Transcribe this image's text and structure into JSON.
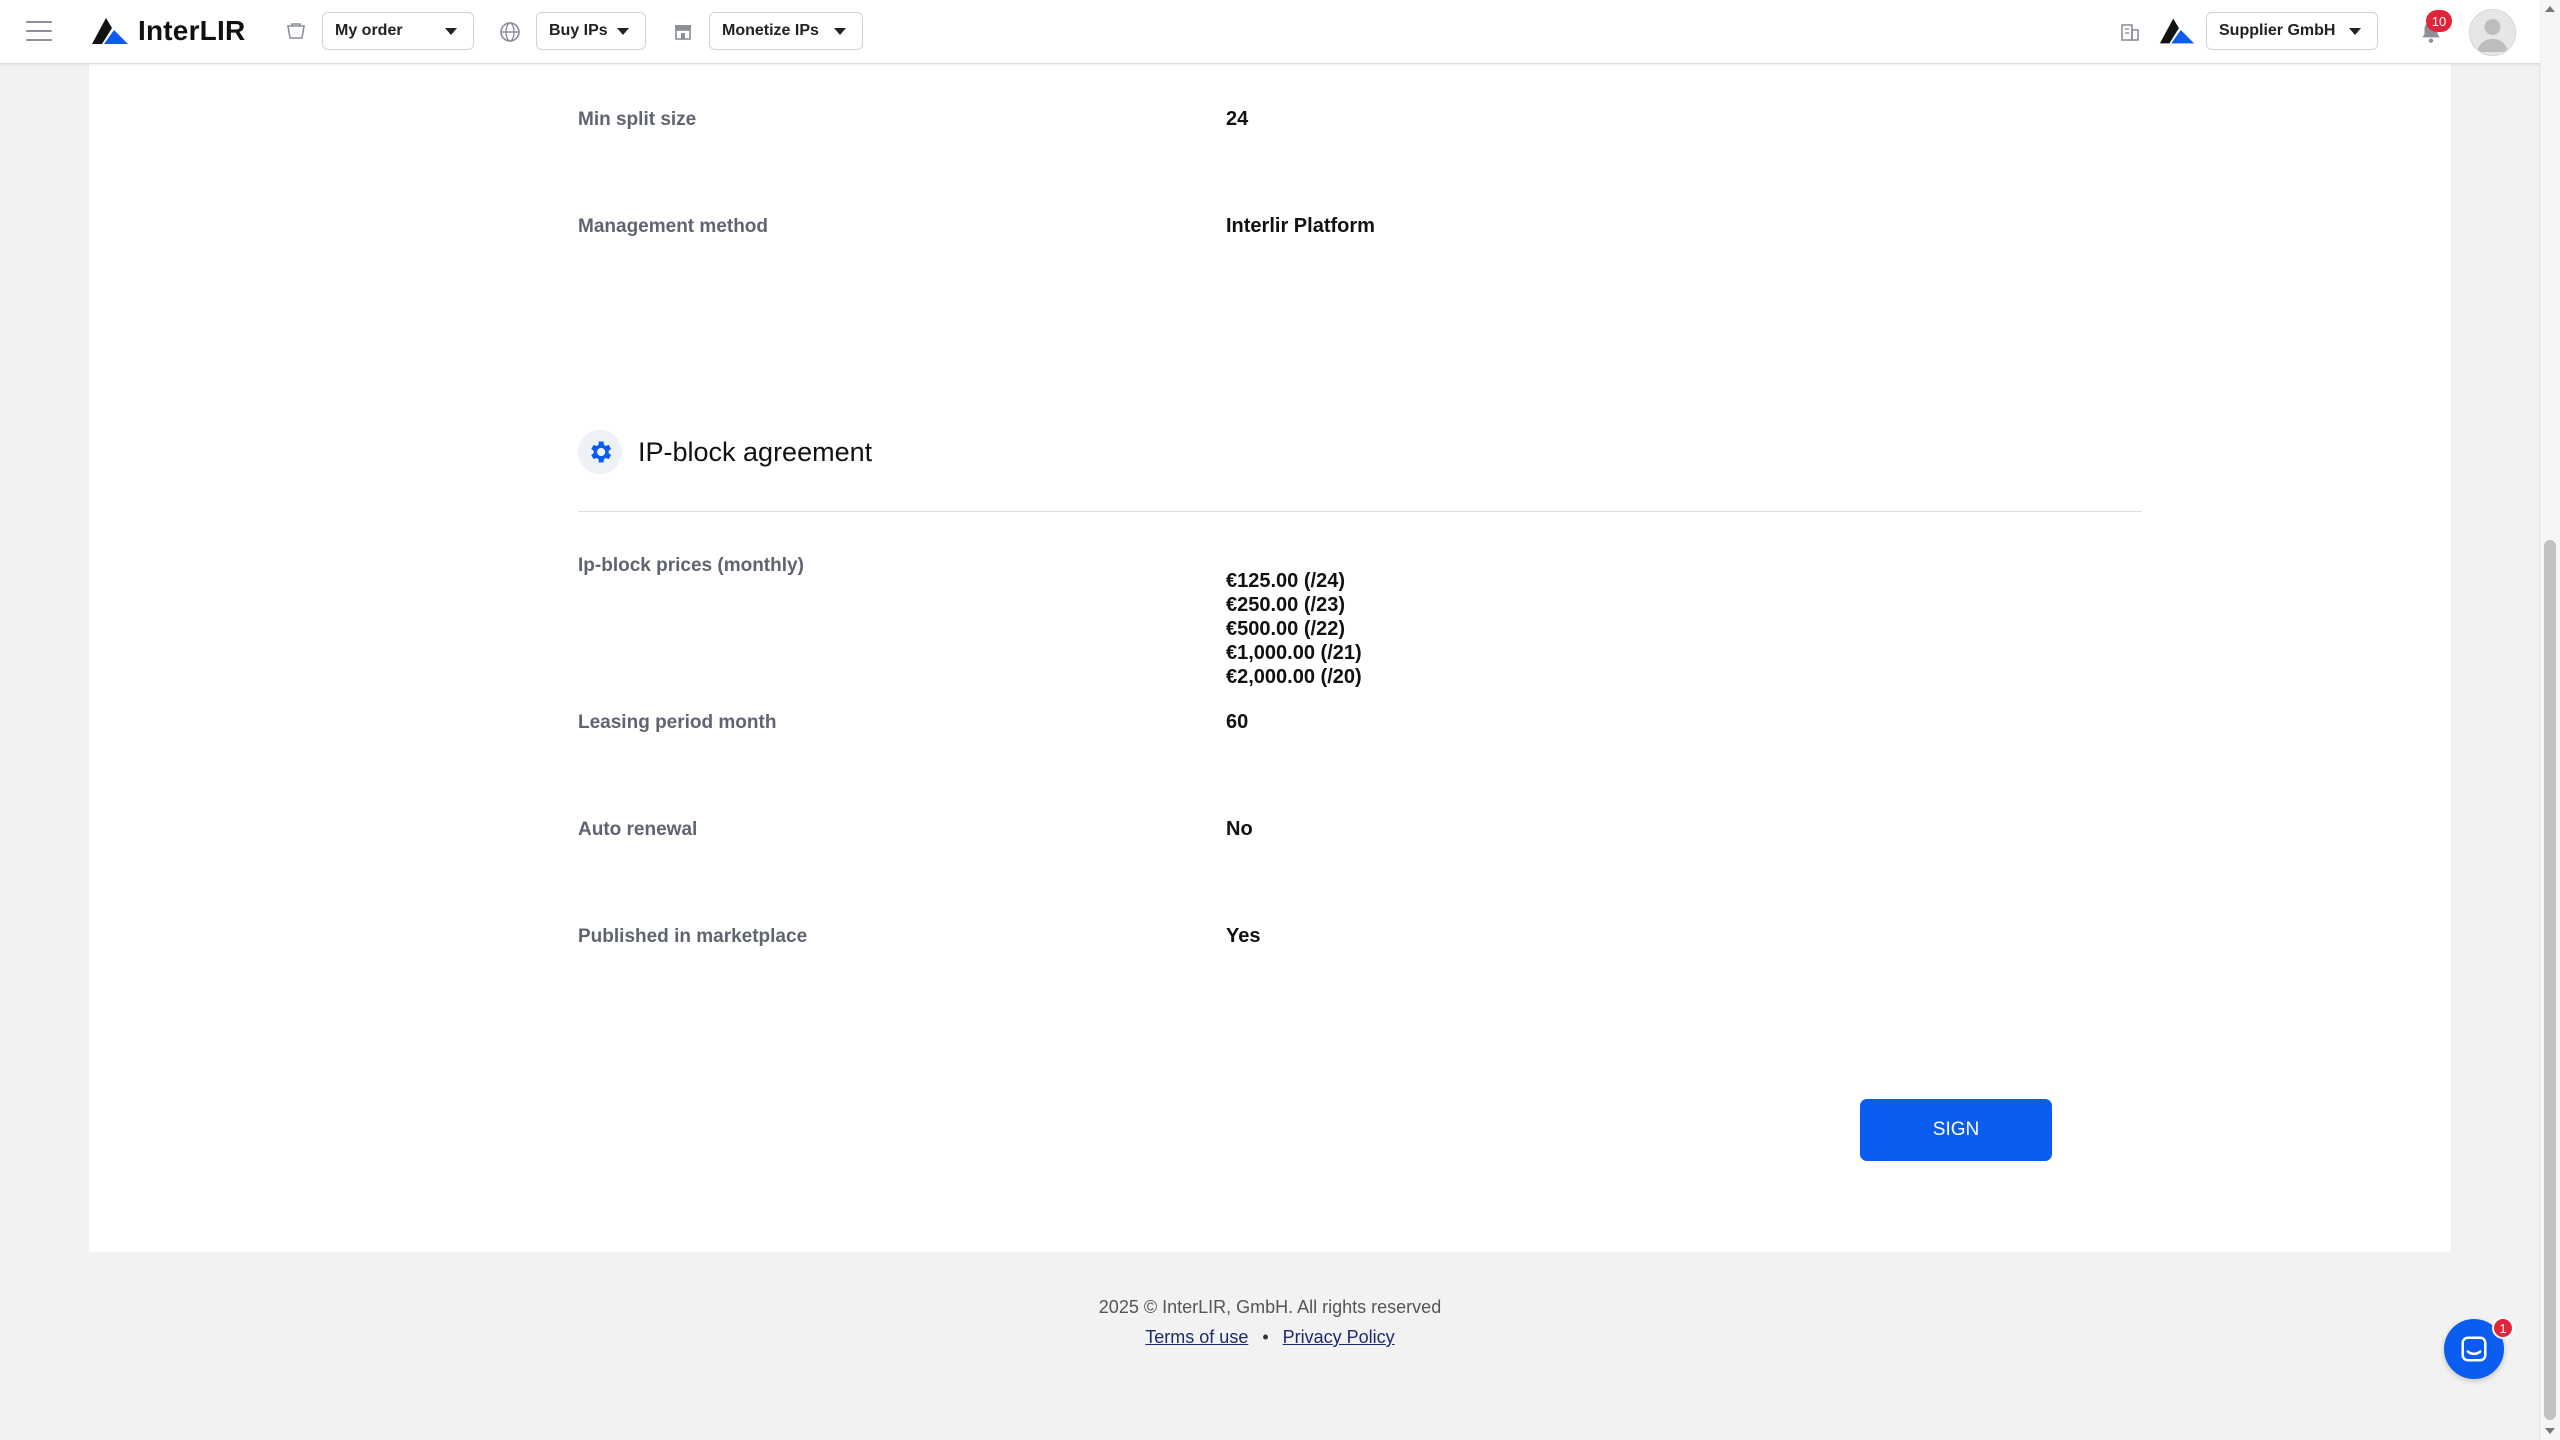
{
  "header": {
    "logo_text": "InterLIR",
    "nav": [
      {
        "label": "My order"
      },
      {
        "label": "Buy IPs"
      },
      {
        "label": "Monetize IPs"
      }
    ],
    "company_select": "Supplier GmbH",
    "notifications_count": "10"
  },
  "details": {
    "min_split_size": {
      "label": "Min split size",
      "value": "24"
    },
    "management_method": {
      "label": "Management method",
      "value": "Interlir Platform"
    }
  },
  "agreement": {
    "title": "IP-block agreement",
    "prices": {
      "label": "Ip-block prices (monthly)",
      "values": [
        "€125.00 (/24)",
        "€250.00 (/23)",
        "€500.00 (/22)",
        "€1,000.00 (/21)",
        "€2,000.00 (/20)"
      ]
    },
    "leasing_period": {
      "label": "Leasing period month",
      "value": "60"
    },
    "auto_renewal": {
      "label": "Auto renewal",
      "value": "No"
    },
    "published": {
      "label": "Published in marketplace",
      "value": "Yes"
    },
    "sign_label": "SIGN"
  },
  "footer": {
    "copyright": "2025 © InterLIR, GmbH. All rights reserved",
    "terms_label": "Terms of use",
    "separator": "•",
    "privacy_label": "Privacy Policy"
  },
  "chat": {
    "badge_count": "1"
  },
  "colors": {
    "accent": "#0b5cf0",
    "badge": "#e0243a"
  }
}
